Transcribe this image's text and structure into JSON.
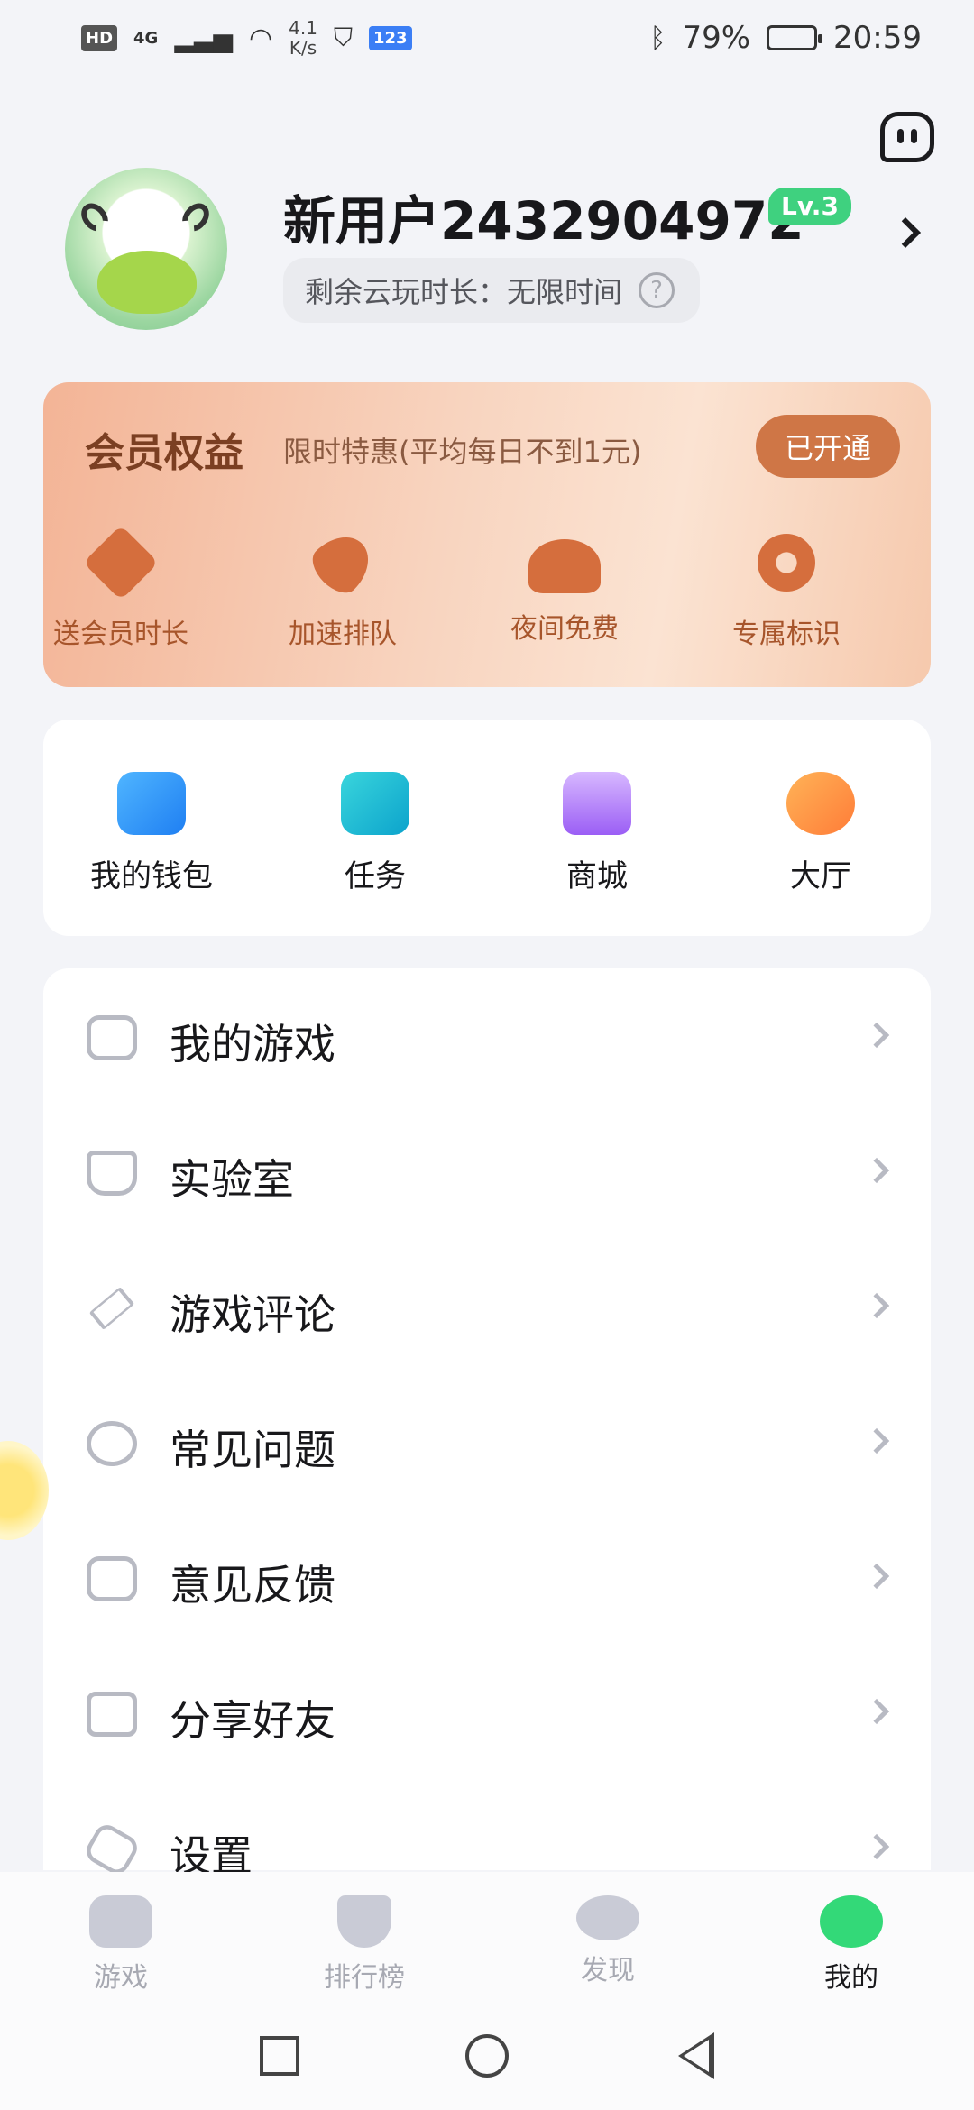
{
  "status_bar": {
    "left_badges": [
      "HD",
      "4G"
    ],
    "speed_value": "4.1",
    "speed_unit": "K/s",
    "app_badge": "123",
    "battery_percent": "79%",
    "battery_level": 0.79,
    "time": "20:59"
  },
  "profile": {
    "username": "新用户2432904972",
    "level": "Lv.3",
    "playtime_label": "剩余云玩时长：",
    "playtime_value": "无限时间",
    "help_icon": "?"
  },
  "membership": {
    "title": "会员权益",
    "subtitle": "限时特惠(平均每日不到1元)",
    "button": "已开通",
    "perks": [
      {
        "label": "送会员时长",
        "icon": "gift-time-icon"
      },
      {
        "label": "加速排队",
        "icon": "rocket-icon"
      },
      {
        "label": "夜间免费",
        "icon": "moon-cloud-icon"
      },
      {
        "label": "专属标识",
        "icon": "medal-icon"
      }
    ]
  },
  "quick_actions": [
    {
      "label": "我的钱包",
      "icon": "wallet-icon"
    },
    {
      "label": "任务",
      "icon": "task-icon"
    },
    {
      "label": "商城",
      "icon": "store-icon"
    },
    {
      "label": "大厅",
      "icon": "lobby-icon"
    }
  ],
  "menu": [
    {
      "label": "我的游戏",
      "icon": "gamepad-icon"
    },
    {
      "label": "实验室",
      "icon": "flask-icon"
    },
    {
      "label": "游戏评论",
      "icon": "pencil-icon"
    },
    {
      "label": "常见问题",
      "icon": "alert-circle-icon"
    },
    {
      "label": "意见反馈",
      "icon": "feedback-icon"
    },
    {
      "label": "分享好友",
      "icon": "share-icon"
    },
    {
      "label": "设置",
      "icon": "settings-icon"
    }
  ],
  "tabbar": {
    "tabs": [
      {
        "label": "游戏",
        "icon": "gamepad-tab-icon"
      },
      {
        "label": "排行榜",
        "icon": "ranking-tab-icon"
      },
      {
        "label": "发现",
        "icon": "discover-tab-icon"
      },
      {
        "label": "我的",
        "icon": "profile-monster-tab-icon"
      }
    ],
    "active_tab": "我的"
  }
}
